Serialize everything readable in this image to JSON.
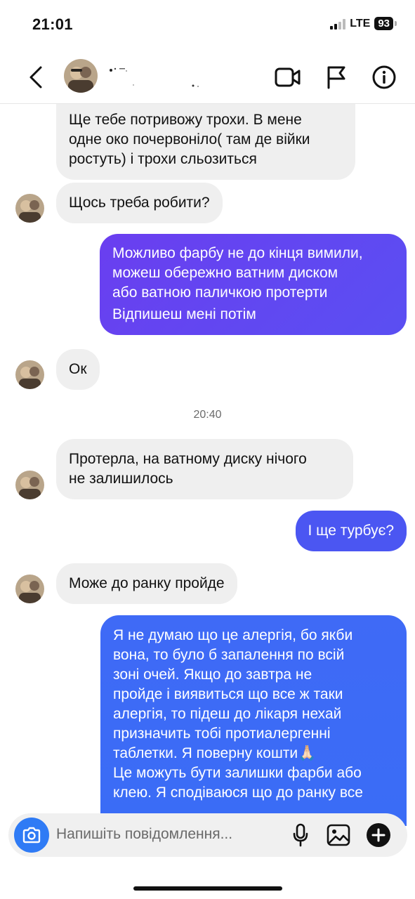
{
  "status_bar": {
    "time": "21:01",
    "network": "LTE",
    "battery": "93"
  },
  "header": {
    "back_icon": "chevron-left-icon",
    "contact_avatar": "avatar-photo",
    "video_icon": "video-camera-icon",
    "report_icon": "flag-icon",
    "info_icon": "info-icon"
  },
  "messages": [
    {
      "direction": "in",
      "lines": [
        "Ще тебе потривожу трохи. В мене",
        "одне око почервоніло( там де війки",
        "ростуть) і трохи сльозиться"
      ]
    },
    {
      "direction": "in",
      "lines": [
        "Щось треба робити?"
      ]
    },
    {
      "direction": "out",
      "lines": [
        "Можливо фарбу не до кінця вимили,",
        "можеш обережно ватним диском",
        "або ватною паличкою протерти",
        "Відпишеш мені потім"
      ]
    },
    {
      "direction": "in",
      "lines": [
        "Ок"
      ]
    },
    {
      "direction": "in",
      "lines": [
        "Протерла, на ватному диску нічого",
        "не залишилось"
      ]
    },
    {
      "direction": "out",
      "lines": [
        "І ще турбує?"
      ]
    },
    {
      "direction": "in",
      "lines": [
        "Може до ранку пройде"
      ]
    },
    {
      "direction": "out",
      "lines": [
        "Я не думаю що це алергія, бо якби",
        "вона, то було б запалення по всій",
        "зоні очей. Якщо до завтра не",
        "пройде і виявиться що все ж таки",
        "алергія, то підеш до лікаря нехай",
        "призначить тобі протиалергенні",
        "таблетки. Я поверну кошти🙏🏻",
        "Це можуть бути залишки фарби або",
        "клею. Я сподіваюся що до ранку все"
      ]
    }
  ],
  "timestamp": "20:40",
  "composer": {
    "placeholder": "Напишіть повідомлення...",
    "camera_icon": "camera-icon",
    "mic_icon": "microphone-icon",
    "gallery_icon": "image-icon",
    "plus_icon": "plus-icon"
  },
  "colors": {
    "incoming_bubble": "#efefef",
    "outgoing_gradient_purple": "#6a3ef0",
    "outgoing_gradient_blue": "#3b6cf6",
    "camera_button": "#2f7bf5"
  }
}
